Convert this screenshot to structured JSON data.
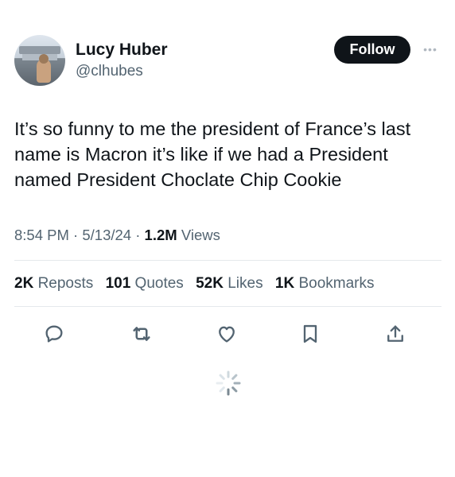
{
  "author": {
    "name": "Lucy Huber",
    "handle": "@clhubes",
    "avatar_icon": "profile-photo"
  },
  "follow_label": "Follow",
  "more_icon": "more-dots-icon",
  "tweet": {
    "text": "It’s so funny to me the president of France’s last name is Macron it’s like if we had a President named President Choclate Chip Cookie",
    "time": "8:54 PM",
    "date": "5/13/24",
    "separator": "·",
    "views_count": "1.2M",
    "views_label": "Views"
  },
  "stats": {
    "reposts_count": "2K",
    "reposts_label": "Reposts",
    "quotes_count": "101",
    "quotes_label": "Quotes",
    "likes_count": "52K",
    "likes_label": "Likes",
    "bookmarks_count": "1K",
    "bookmarks_label": "Bookmarks"
  },
  "actions": [
    "reply-icon",
    "repost-icon",
    "like-icon",
    "bookmark-icon",
    "share-icon"
  ],
  "colors": {
    "text_primary": "#0f1419",
    "text_secondary": "#536471",
    "button_bg": "#0f1419",
    "icon_color": "#536471"
  }
}
